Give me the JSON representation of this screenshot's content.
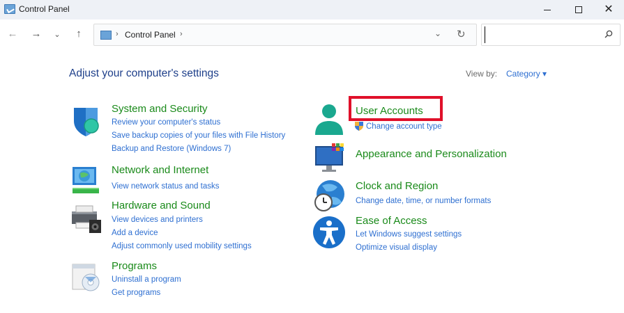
{
  "window": {
    "title": "Control Panel"
  },
  "nav": {
    "back_glyph": "←",
    "forward_glyph": "→",
    "recent_glyph": "⌄",
    "up_glyph": "↑"
  },
  "address": {
    "separator": "›",
    "location": "Control Panel",
    "dropdown_glyph": "⌄",
    "refresh_glyph": "↻"
  },
  "search": {
    "value": "",
    "placeholder": ""
  },
  "main": {
    "heading": "Adjust your computer's settings",
    "view_by_label": "View by:",
    "view_by_value": "Category ▾"
  },
  "categories_left": [
    {
      "title": "System and Security",
      "icon": "shield-icon",
      "links": [
        "Review your computer's status",
        "Save backup copies of your files with File History",
        "Backup and Restore (Windows 7)"
      ]
    },
    {
      "title": "Network and Internet",
      "icon": "network-globe-icon",
      "links": [
        "View network status and tasks"
      ]
    },
    {
      "title": "Hardware and Sound",
      "icon": "printer-speaker-icon",
      "links": [
        "View devices and printers",
        "Add a device",
        "Adjust commonly used mobility settings"
      ]
    },
    {
      "title": "Programs",
      "icon": "programs-icon",
      "links": [
        "Uninstall a program",
        "Get programs"
      ]
    }
  ],
  "categories_right": [
    {
      "title": "User Accounts",
      "icon": "user-icon",
      "links": [
        "Change account type"
      ]
    },
    {
      "title": "Appearance and Personalization",
      "icon": "monitor-icon",
      "links": []
    },
    {
      "title": "Clock and Region",
      "icon": "clock-globe-icon",
      "links": [
        "Change date, time, or number formats"
      ]
    },
    {
      "title": "Ease of Access",
      "icon": "accessibility-icon",
      "links": [
        "Let Windows suggest settings",
        "Optimize visual display"
      ]
    }
  ],
  "colors": {
    "heading": "#1e3f8a",
    "category_title": "#1a8a1a",
    "link": "#2e6fd1",
    "highlight": "#e0102a"
  }
}
